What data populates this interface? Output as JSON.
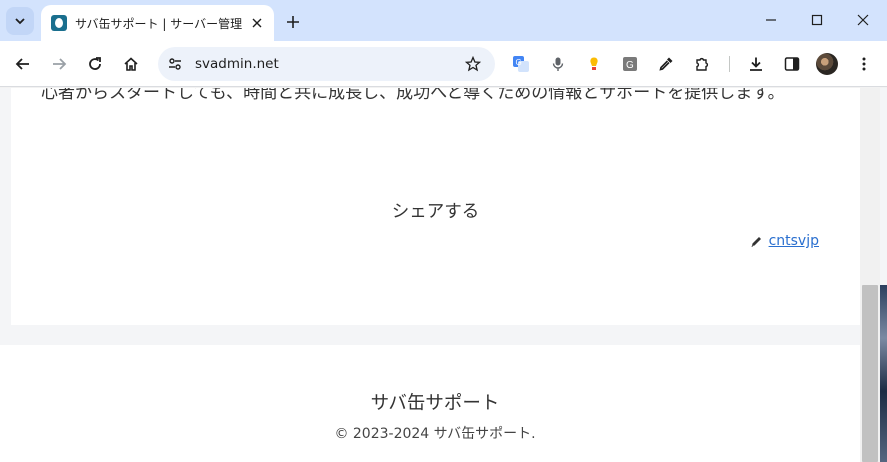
{
  "browser": {
    "tab_title": "サバ缶サポート | サーバー管理者の系",
    "url": "svadmin.net",
    "colors": {
      "tabstrip": "#d3e3fd",
      "omnibox": "#edf2fa",
      "favicon": "#1a6f8e"
    }
  },
  "page": {
    "body_text": "心者からスタートしても、時間と共に成長し、成功へと導くための情報とサポートを提供します。",
    "share_label": "シェアする",
    "author_name": "cntsvjp",
    "footer_title": "サバ缶サポート",
    "copyright": "© 2023-2024 サバ缶サポート."
  }
}
